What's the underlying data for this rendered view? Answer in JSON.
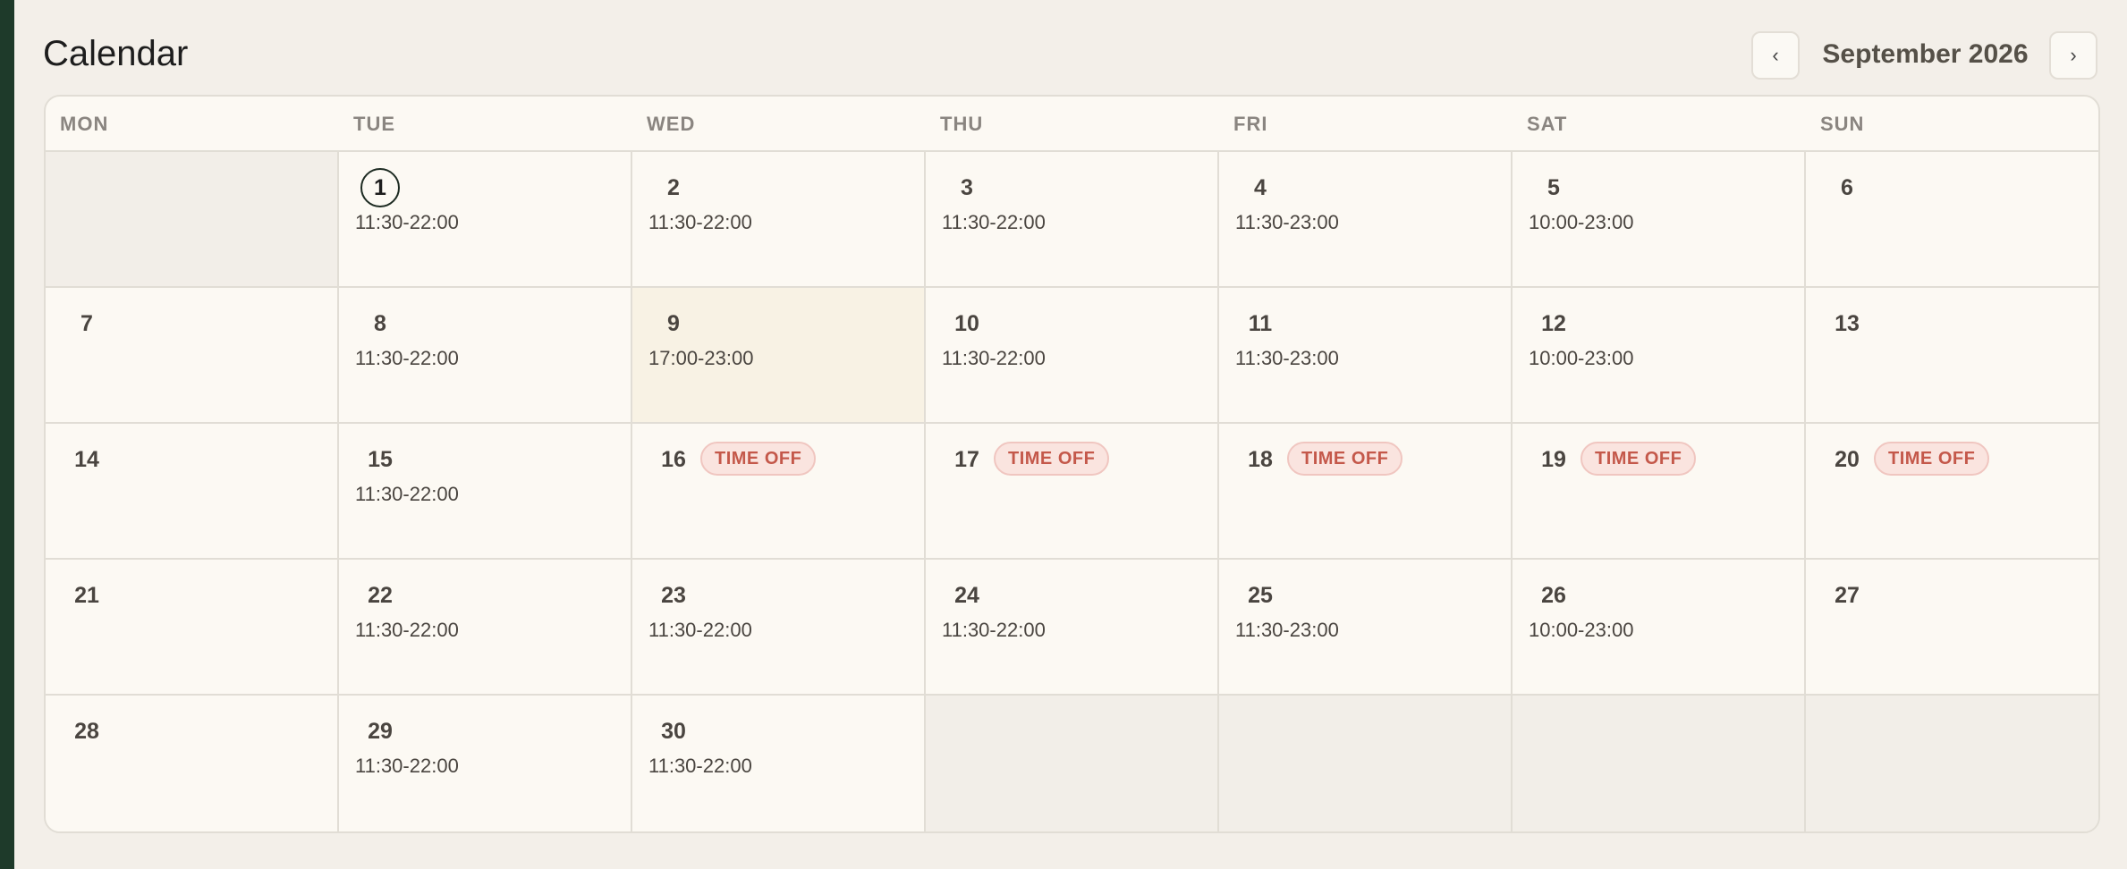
{
  "header": {
    "title": "Calendar",
    "month_label": "September 2026",
    "prev_icon": "‹",
    "next_icon": "›"
  },
  "weekdays": [
    "MON",
    "TUE",
    "WED",
    "THU",
    "FRI",
    "SAT",
    "SUN"
  ],
  "weeks": [
    [
      {
        "day": "",
        "hours": "",
        "outside": true
      },
      {
        "day": "1",
        "hours": "11:30-22:00",
        "today": true
      },
      {
        "day": "2",
        "hours": "11:30-22:00"
      },
      {
        "day": "3",
        "hours": "11:30-22:00"
      },
      {
        "day": "4",
        "hours": "11:30-23:00"
      },
      {
        "day": "5",
        "hours": "10:00-23:00"
      },
      {
        "day": "6",
        "hours": ""
      }
    ],
    [
      {
        "day": "7",
        "hours": ""
      },
      {
        "day": "8",
        "hours": "11:30-22:00"
      },
      {
        "day": "9",
        "hours": "17:00-23:00",
        "selected": true
      },
      {
        "day": "10",
        "hours": "11:30-22:00"
      },
      {
        "day": "11",
        "hours": "11:30-23:00"
      },
      {
        "day": "12",
        "hours": "10:00-23:00"
      },
      {
        "day": "13",
        "hours": ""
      }
    ],
    [
      {
        "day": "14",
        "hours": ""
      },
      {
        "day": "15",
        "hours": "11:30-22:00"
      },
      {
        "day": "16",
        "hours": "",
        "badge": "TIME OFF"
      },
      {
        "day": "17",
        "hours": "",
        "badge": "TIME OFF"
      },
      {
        "day": "18",
        "hours": "",
        "badge": "TIME OFF"
      },
      {
        "day": "19",
        "hours": "",
        "badge": "TIME OFF"
      },
      {
        "day": "20",
        "hours": "",
        "badge": "TIME OFF"
      }
    ],
    [
      {
        "day": "21",
        "hours": ""
      },
      {
        "day": "22",
        "hours": "11:30-22:00"
      },
      {
        "day": "23",
        "hours": "11:30-22:00"
      },
      {
        "day": "24",
        "hours": "11:30-22:00"
      },
      {
        "day": "25",
        "hours": "11:30-23:00"
      },
      {
        "day": "26",
        "hours": "10:00-23:00"
      },
      {
        "day": "27",
        "hours": ""
      }
    ],
    [
      {
        "day": "28",
        "hours": ""
      },
      {
        "day": "29",
        "hours": "11:30-22:00"
      },
      {
        "day": "30",
        "hours": "11:30-22:00"
      },
      {
        "day": "",
        "hours": "",
        "outside": true
      },
      {
        "day": "",
        "hours": "",
        "outside": true
      },
      {
        "day": "",
        "hours": "",
        "outside": true
      },
      {
        "day": "",
        "hours": "",
        "outside": true
      }
    ]
  ],
  "colors": {
    "accent_dark": "#1e3a2a",
    "time_off_bg": "#fae4df",
    "time_off_text": "#c4584a",
    "selected_bg": "#f8f2e4"
  }
}
